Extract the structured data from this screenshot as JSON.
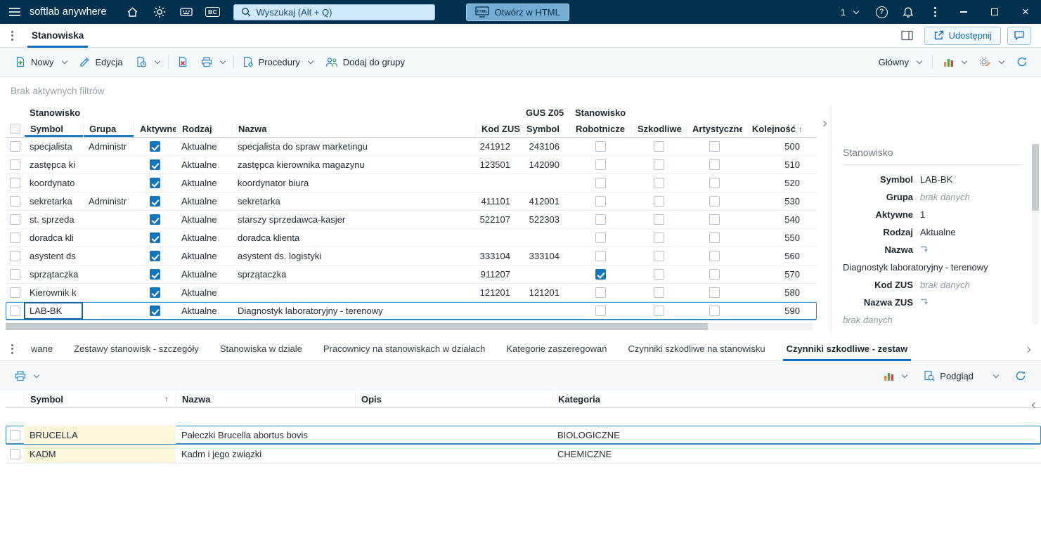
{
  "topbar": {
    "app_title": "softlab anywhere",
    "bc_badge": "BC",
    "search_placeholder": "Wyszukaj (Alt + Q)",
    "open_in_html_label": "Otwórz w HTML",
    "environment_count": "1"
  },
  "tabbar": {
    "tab_label": "Stanowiska",
    "share_label": "Udostępnij"
  },
  "toolbar": {
    "new_label": "Nowy",
    "edit_label": "Edycja",
    "procedures_label": "Procedury",
    "add_to_group_label": "Dodaj do grupy",
    "view_label": "Główny"
  },
  "filter_text": "Brak aktywnych filtrów",
  "main_table": {
    "groups": [
      "Stanowisko",
      "GUS Z05",
      "Stanowisko"
    ],
    "columns": [
      "Symbol",
      "Grupa",
      "Aktywne",
      "Rodzaj",
      "Nazwa",
      "Kod ZUS",
      "Symbol",
      "Robotnicze",
      "Szkodliwe",
      "Artystyczne",
      "Kolejność"
    ],
    "rows": [
      {
        "symbol": "specjalista",
        "grupa": "Administr",
        "aktywne": true,
        "rodzaj": "Aktualne",
        "nazwa": "specjalista do spraw marketingu",
        "kod_zus": "241912",
        "gus_symbol": "243106",
        "robotnicze": false,
        "szkodliwe": false,
        "artystyczne": false,
        "kolejnosc": "500",
        "selected": false
      },
      {
        "symbol": "zastępca ki",
        "grupa": "",
        "aktywne": true,
        "rodzaj": "Aktualne",
        "nazwa": "zastępca kierownika magazynu",
        "kod_zus": "123501",
        "gus_symbol": "142090",
        "robotnicze": false,
        "szkodliwe": false,
        "artystyczne": false,
        "kolejnosc": "510",
        "selected": false
      },
      {
        "symbol": "koordynato",
        "grupa": "",
        "aktywne": true,
        "rodzaj": "Aktualne",
        "nazwa": "koordynator biura",
        "kod_zus": "",
        "gus_symbol": "",
        "robotnicze": false,
        "szkodliwe": false,
        "artystyczne": false,
        "kolejnosc": "520",
        "selected": false
      },
      {
        "symbol": "sekretarka",
        "grupa": "Administr",
        "aktywne": true,
        "rodzaj": "Aktualne",
        "nazwa": "sekretarka",
        "kod_zus": "411101",
        "gus_symbol": "412001",
        "robotnicze": false,
        "szkodliwe": false,
        "artystyczne": false,
        "kolejnosc": "530",
        "selected": false
      },
      {
        "symbol": "st. sprzeda",
        "grupa": "",
        "aktywne": true,
        "rodzaj": "Aktualne",
        "nazwa": "starszy sprzedawca-kasjer",
        "kod_zus": "522107",
        "gus_symbol": "522303",
        "robotnicze": false,
        "szkodliwe": false,
        "artystyczne": false,
        "kolejnosc": "540",
        "selected": false
      },
      {
        "symbol": "doradca kli",
        "grupa": "",
        "aktywne": true,
        "rodzaj": "Aktualne",
        "nazwa": "doradca klienta",
        "kod_zus": "",
        "gus_symbol": "",
        "robotnicze": false,
        "szkodliwe": false,
        "artystyczne": false,
        "kolejnosc": "550",
        "selected": false
      },
      {
        "symbol": "asystent ds",
        "grupa": "",
        "aktywne": true,
        "rodzaj": "Aktualne",
        "nazwa": "asystent ds. logistyki",
        "kod_zus": "333104",
        "gus_symbol": "333104",
        "robotnicze": false,
        "szkodliwe": false,
        "artystyczne": false,
        "kolejnosc": "560",
        "selected": false
      },
      {
        "symbol": "sprzątaczka",
        "grupa": "",
        "aktywne": true,
        "rodzaj": "Aktualne",
        "nazwa": "sprzątaczka",
        "kod_zus": "911207",
        "gus_symbol": "",
        "robotnicze": true,
        "szkodliwe": false,
        "artystyczne": false,
        "kolejnosc": "570",
        "selected": false
      },
      {
        "symbol": "Kierownik k",
        "grupa": "",
        "aktywne": true,
        "rodzaj": "Aktualne",
        "nazwa": "",
        "kod_zus": "121201",
        "gus_symbol": "121201",
        "robotnicze": false,
        "szkodliwe": false,
        "artystyczne": false,
        "kolejnosc": "580",
        "selected": false
      },
      {
        "symbol": "LAB-BK",
        "grupa": "",
        "aktywne": true,
        "rodzaj": "Aktualne",
        "nazwa": "Diagnostyk laboratoryjny - terenowy",
        "kod_zus": "",
        "gus_symbol": "",
        "robotnicze": false,
        "szkodliwe": false,
        "artystyczne": false,
        "kolejnosc": "590",
        "selected": true
      }
    ]
  },
  "factbox": {
    "title": "Stanowisko",
    "fields": [
      {
        "label": "Symbol",
        "value": "LAB-BK"
      },
      {
        "label": "Grupa",
        "value": "brak danych",
        "muted": true
      },
      {
        "label": "Aktywne",
        "value": "1"
      },
      {
        "label": "Rodzaj",
        "value": "Aktualne"
      },
      {
        "label": "Nazwa",
        "wrap_icon": true
      },
      {
        "full": "Diagnostyk laboratoryjny - terenowy"
      },
      {
        "label": "Kod ZUS",
        "value": "brak danych",
        "muted": true
      },
      {
        "label": "Nazwa ZUS",
        "wrap_icon": true
      },
      {
        "full": "brak danych",
        "muted": true
      }
    ]
  },
  "bottom_tabs": [
    {
      "label": "wane",
      "active": false
    },
    {
      "label": "Zestawy stanowisk - szczegóły",
      "active": false
    },
    {
      "label": "Stanowiska w dziale",
      "active": false
    },
    {
      "label": "Pracownicy na stanowiskach w działach",
      "active": false
    },
    {
      "label": "Kategorie zaszeregowań",
      "active": false
    },
    {
      "label": "Czynniki szkodliwe na stanowisku",
      "active": false
    },
    {
      "label": "Czynniki szkodliwe - zestaw",
      "active": true
    }
  ],
  "bottom_toolbar": {
    "preview_label": "Podgląd"
  },
  "bottom_table": {
    "columns": [
      "Symbol",
      "Nazwa",
      "Opis",
      "Kategoria"
    ],
    "rows": [
      {
        "symbol": "BRUCELLA",
        "nazwa": "Pałeczki Brucella abortus bovis",
        "opis": "",
        "kategoria": "BIOLOGICZNE",
        "selected": true
      },
      {
        "symbol": "KADM",
        "nazwa": "Kadm i jego związki",
        "opis": "",
        "kategoria": "CHEMICZNE",
        "selected": false
      }
    ]
  },
  "colors": {
    "accent": "#0f6cbd",
    "topbar_bg": "#003250",
    "checkbox_checked": "#1276bd",
    "selection_border": "#2e8bc7",
    "symbol_cell_bg": "#fbf6d9"
  }
}
